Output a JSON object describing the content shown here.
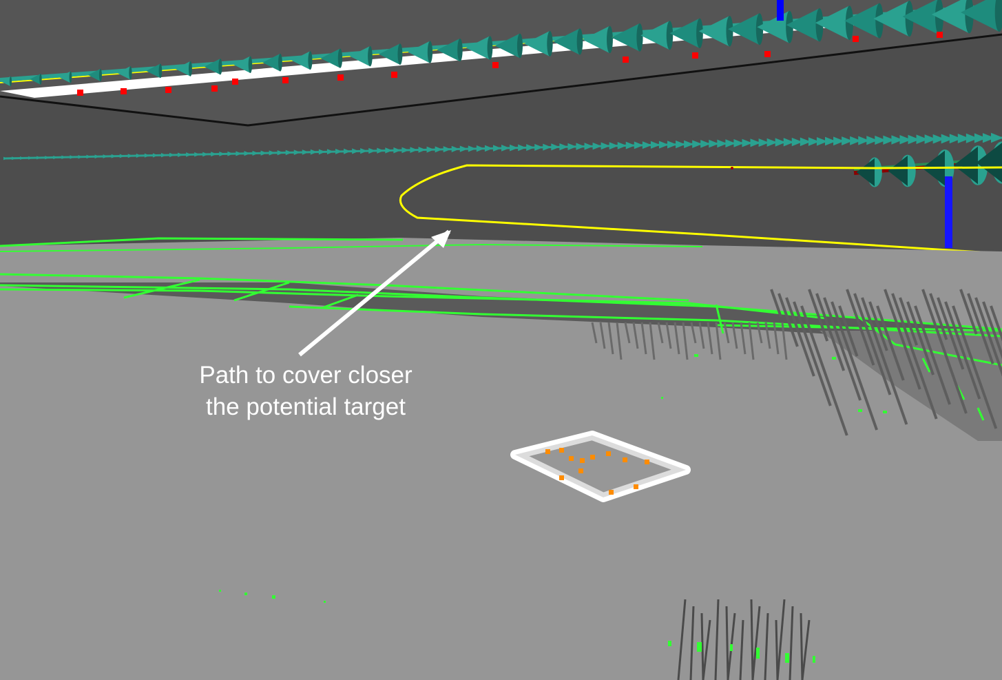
{
  "annotation": {
    "line1": "Path to cover closer",
    "line2": "the potential target"
  },
  "colors": {
    "background": "#4d4d4d",
    "ground": "#969696",
    "grid_line": "#33ff33",
    "planned_path": "#ffff00",
    "pose_arrows": "#1e8c7d",
    "markers": "#ff0000",
    "axis": "#0000ff",
    "target_frame": "#ffffff",
    "target_points": "#ff8c00"
  },
  "icons": {
    "arrow": "annotation-arrow-icon",
    "target": "target-frame-icon"
  }
}
